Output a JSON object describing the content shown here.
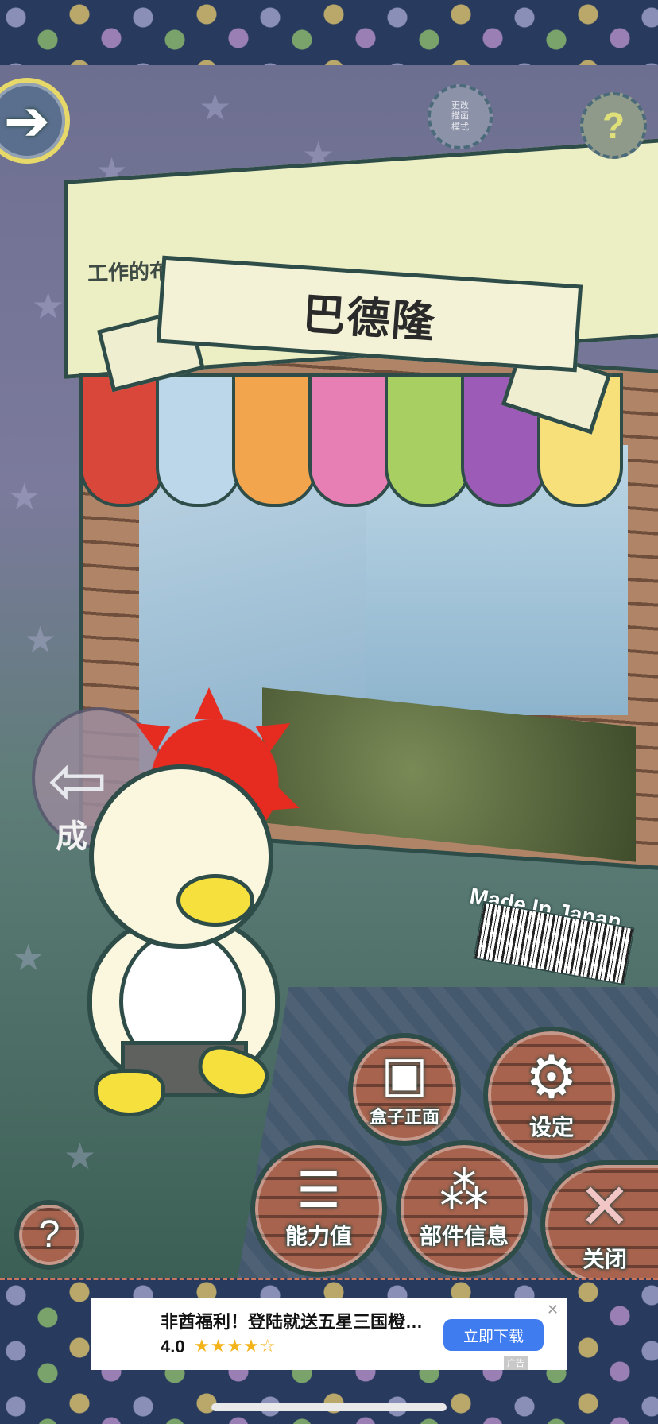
{
  "box": {
    "label": "工作的布偶",
    "name": "巴德隆",
    "made_in": "Made In Japan"
  },
  "left_sign": {
    "text": "成"
  },
  "top_buttons": {
    "change_mode_label": "更改\n描画\n模式",
    "help_glyph": "?"
  },
  "buttons": {
    "box_front": "盒子正面",
    "settings": "设定",
    "stats": "能力值",
    "parts_info": "部件信息",
    "close": "关闭",
    "help": "?"
  },
  "ad": {
    "title": "非酋福利！登陆就送五星三国橙…",
    "rating": "4.0",
    "stars": "★★★★☆",
    "cta": "立即下载",
    "close": "✕",
    "mark": "广告"
  },
  "colors": {
    "outline": "#2e4c48",
    "duck_yellow": "#f6e03d",
    "spiky_red": "#e62b20",
    "ad_button": "#3f7cf0"
  }
}
